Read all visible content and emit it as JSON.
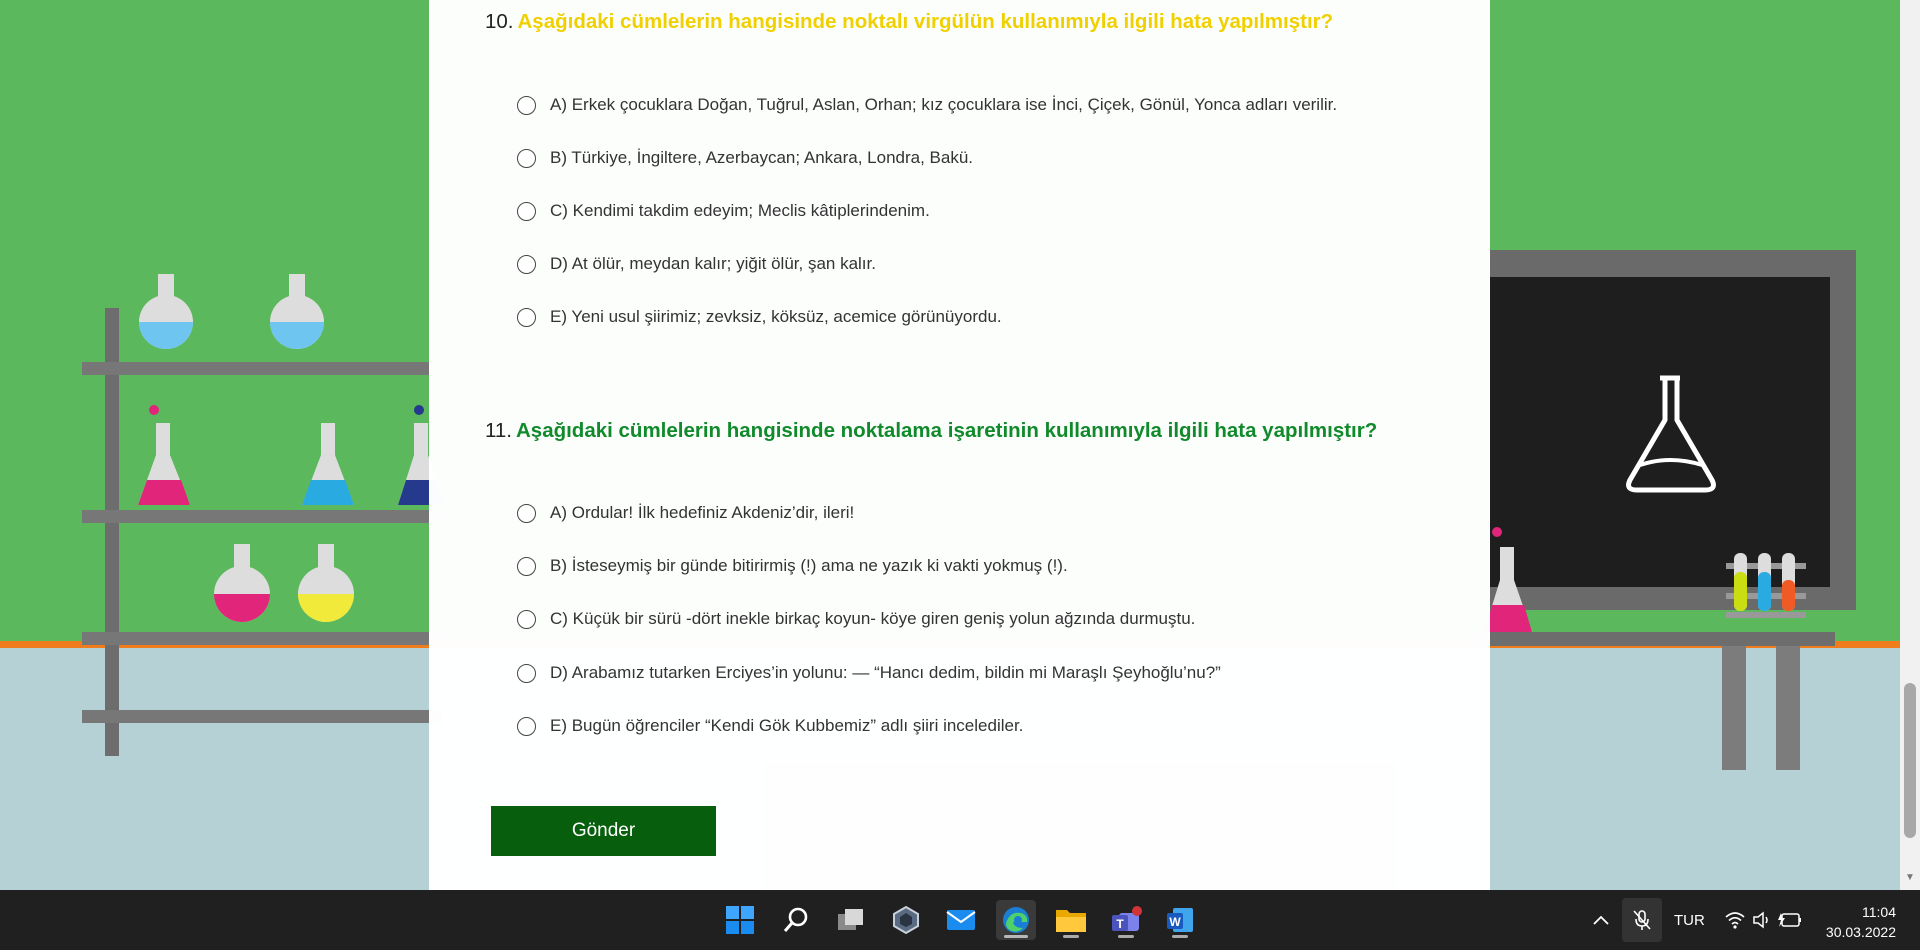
{
  "questions": [
    {
      "number": "10.",
      "text": "Aşağıdaki cümlelerin hangisinde noktalı virgülün kullanımıyla ilgili hata yapılmıştır?",
      "options": [
        "A) Erkek çocuklara Doğan, Tuğrul, Aslan, Orhan; kız çocuklara ise İnci, Çiçek, Gönül, Yonca adları verilir.",
        "B) Türkiye, İngiltere, Azerbaycan; Ankara, Londra, Bakü.",
        "C) Kendimi takdim edeyim; Meclis kâtiplerindenim.",
        "D) At ölür, meydan kalır; yiğit ölür, şan kalır.",
        "E) Yeni usul şiirimiz; zevksiz, köksüz, acemice görünüyordu."
      ]
    },
    {
      "number": "11.",
      "text": "Aşağıdaki cümlelerin hangisinde noktalama işaretinin kullanımıyla ilgili hata yapılmıştır?",
      "options": [
        "A) Ordular! İlk hedefiniz Akdeniz’dir, ileri!",
        "B) İsteseymiş bir günde bitirirmiş (!) ama ne yazık ki vakti yokmuş (!).",
        "C) Küçük bir sürü -dört inekle birkaç koyun- köye giren geniş yolun ağzında durmuştu.",
        "D) Arabamız tutarken Erciyes’in yolunu: — “Hancı dedim, bildin mi Maraşlı Şeyhoğlu’nu?”",
        "E) Bugün öğrenciler “Kendi Gök Kubbemiz” adlı şiiri incelediler."
      ]
    }
  ],
  "submit_label": "Gönder",
  "colors": {
    "q10_title": "#f0d000",
    "q11_title": "#118a2c",
    "submit_bg": "#075e0c",
    "wall": "#5cb85c",
    "floor": "#b5d1d6",
    "chalkboard": "#1e1e1e"
  },
  "taskbar": {
    "apps": [
      "start-icon",
      "search-icon",
      "task-view-icon",
      "widgets-icon",
      "mail-icon",
      "edge-icon",
      "file-explorer-icon",
      "teams-icon",
      "word-icon"
    ],
    "language": "TUR",
    "time": "11:04",
    "date": "30.03.2022"
  }
}
